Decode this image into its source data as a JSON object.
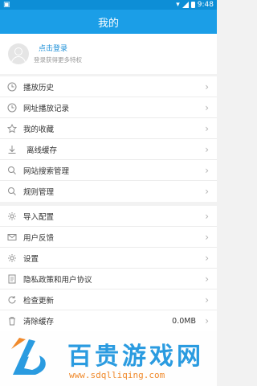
{
  "statusbar": {
    "time": "9:48"
  },
  "header": {
    "title": "我的"
  },
  "account": {
    "login_title": "点击登录",
    "login_subtitle": "登录获得更多特权"
  },
  "menu_group1": [
    {
      "label": "播放历史",
      "icon": "clock-icon"
    },
    {
      "label": "网址播放记录",
      "icon": "clock-icon"
    },
    {
      "label": "我的收藏",
      "icon": "star-icon"
    },
    {
      "label": "离线缓存",
      "icon": "download-icon"
    },
    {
      "label": "网站搜索管理",
      "icon": "search-icon"
    },
    {
      "label": "规则管理",
      "icon": "search-icon"
    }
  ],
  "menu_group2": [
    {
      "label": "导入配置",
      "icon": "gear-icon"
    },
    {
      "label": "用户反馈",
      "icon": "mail-icon"
    },
    {
      "label": "设置",
      "icon": "gear-icon"
    },
    {
      "label": "隐私政策和用户协议",
      "icon": "document-icon"
    },
    {
      "label": "检查更新",
      "icon": "refresh-icon"
    },
    {
      "label": "清除缓存",
      "icon": "trash-icon",
      "value": "0.0MB"
    }
  ],
  "watermark": {
    "title": "百贵游戏网",
    "url": "www.sdqlliqing.com"
  }
}
